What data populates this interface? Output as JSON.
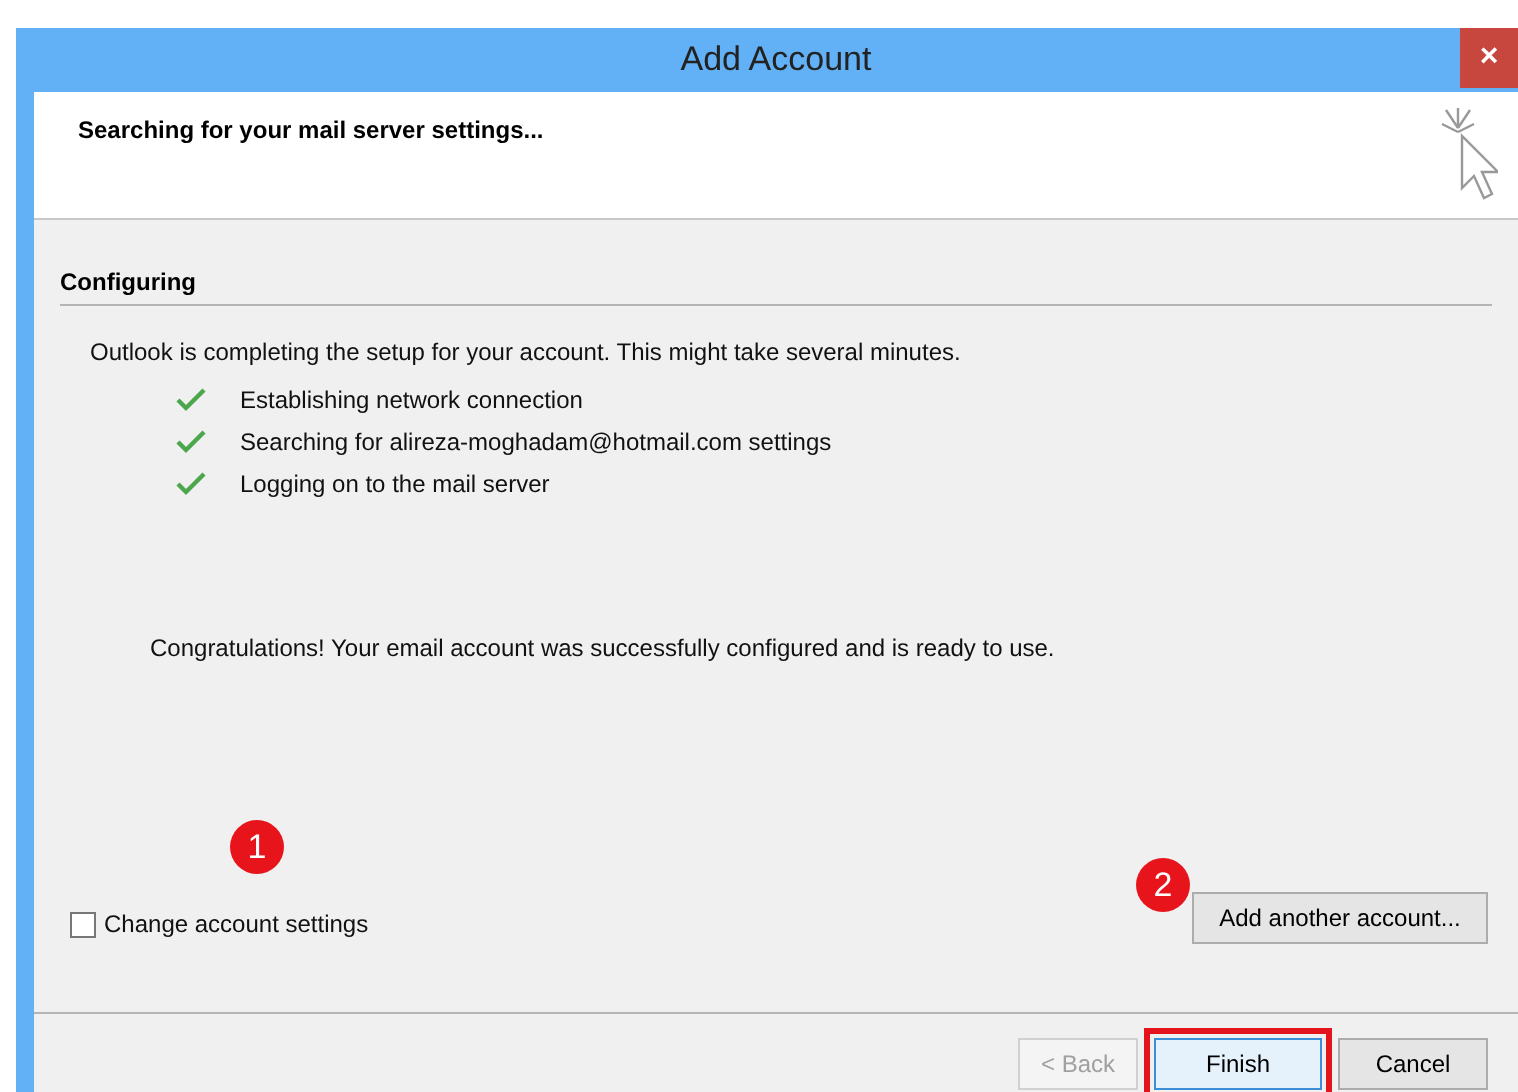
{
  "window": {
    "title": "Add Account",
    "close": "×"
  },
  "header": {
    "title": "Searching for your mail server settings..."
  },
  "section": {
    "title": "Configuring",
    "intro": "Outlook is completing the setup for your account. This might take several minutes.",
    "steps": [
      {
        "label": "Establishing network connection",
        "done": true
      },
      {
        "label": "Searching for alireza-moghadam@hotmail.com settings",
        "done": true
      },
      {
        "label": "Logging on to the mail server",
        "done": true
      }
    ],
    "message": "Congratulations! Your email account was successfully configured and is ready to use."
  },
  "change_settings": {
    "label": "Change account settings",
    "checked": false
  },
  "add_another": {
    "label": "Add another account..."
  },
  "buttons": [
    {
      "label": "< Back",
      "disabled": true,
      "default": false,
      "highlighted": false
    },
    {
      "label": "Finish",
      "disabled": false,
      "default": true,
      "highlighted": true
    },
    {
      "label": "Cancel",
      "disabled": false,
      "default": false,
      "highlighted": false
    }
  ],
  "annotations": [
    "1",
    "2"
  ]
}
